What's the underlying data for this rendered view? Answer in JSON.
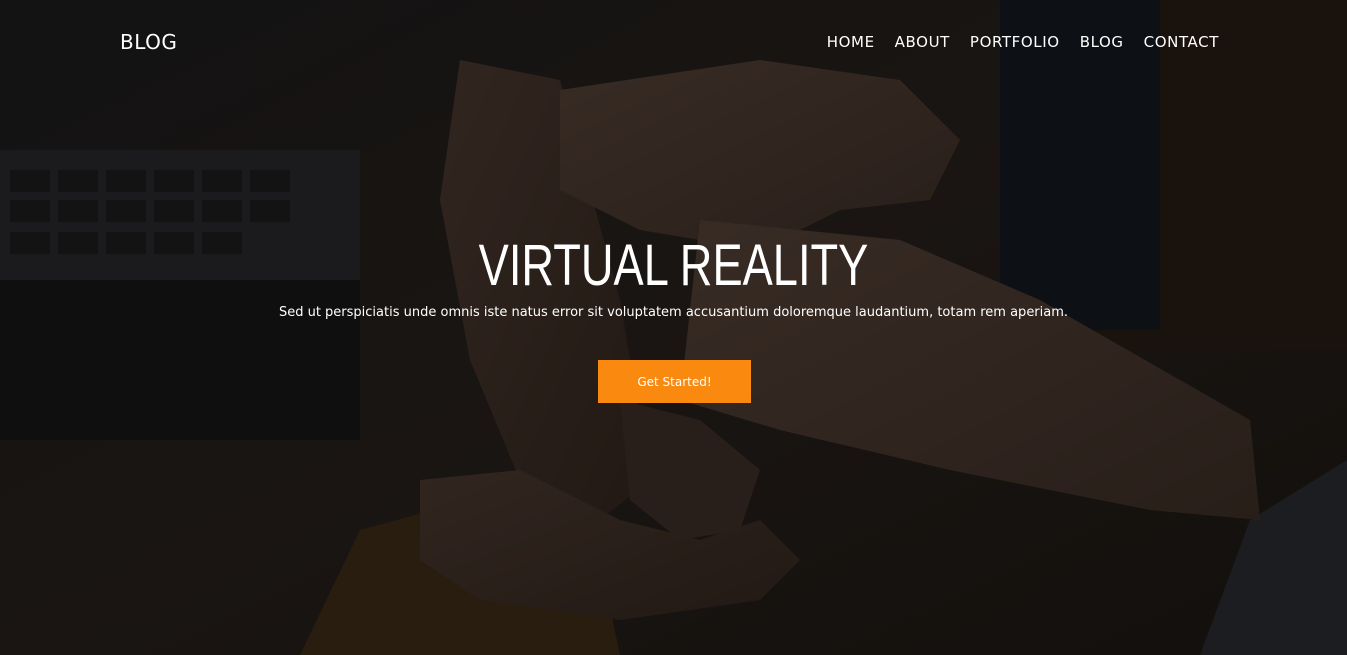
{
  "header": {
    "logo": "BLOG",
    "nav": [
      "HOME",
      "ABOUT",
      "PORTFOLIO",
      "BLOG",
      "CONTACT"
    ]
  },
  "hero": {
    "title": "VIRTUAL REALITY",
    "subtitle": "Sed ut perspiciatis unde omnis iste natus error sit voluptatem accusantium doloremque laudantium, totam rem aperiam.",
    "cta_label": "Get Started!",
    "background_image": "team-hands-stacked-icon"
  },
  "colors": {
    "accent": "#f98a0f",
    "text": "#ffffff"
  }
}
